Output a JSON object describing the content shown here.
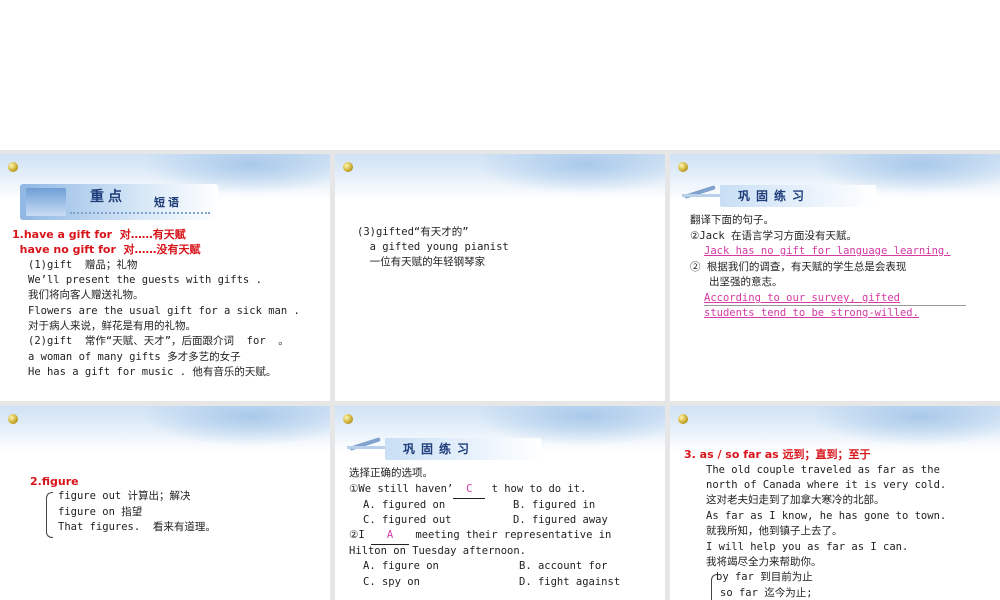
{
  "slide1": {
    "badge_main": "重点",
    "badge_sub": "短语",
    "lines": [
      "1.have a gift for  对……有天赋",
      "  have no gift for  对……没有天赋"
    ],
    "body": [
      "(1)gift  赠品；礼物",
      "We’ll present the guests with gifts .",
      "我们将向客人赠送礼物。",
      "Flowers are the usual gift for a sick man .",
      "对于病人来说，鲜花是有用的礼物。",
      "(2)gift  常作“天赋、天才”，后面跟介词  for  。",
      "a woman of many gifts 多才多艺的女子",
      "He has a gift for music . 他有音乐的天赋。"
    ]
  },
  "slide2": {
    "body": [
      "(3)gifted“有天才的”",
      "  a gifted young pianist",
      "  一位有天赋的年轻钢琴家"
    ]
  },
  "slide3": {
    "banner": "巩固练习",
    "intro": "翻译下面的句子。",
    "q1": "②Jack 在语言学习方面没有天赋。",
    "a1": "Jack has no gift for language learning.",
    "q2a": "② 根据我们的调查，有天赋的学生总是会表现",
    "q2b": "   出坚强的意志。",
    "a2a": "According to our survey, gifted",
    "a2b": "students tend to be strong-willed."
  },
  "slide4": {
    "heading": "2.figure",
    "items": [
      "figure out 计算出；解决",
      "figure on 指望",
      "That figures.  看来有道理。"
    ]
  },
  "slide5": {
    "banner": "巩固练习",
    "intro": "选择正确的选项。",
    "q1_pre": "①We still haven’",
    "q1_ans": "C",
    "q1_post": " t how to do it.",
    "q1_opts": [
      "A. figured on",
      "B. figured in",
      "C. figured out",
      "D. figured away"
    ],
    "q2_pre": "②I ",
    "q2_ans": "A",
    "q2_post": " meeting their representative in",
    "q2_line2": "Hilton on Tuesday afternoon.",
    "q2_opts": [
      "A. figure on",
      "B. account for",
      "C. spy on",
      "D. fight against"
    ]
  },
  "slide6": {
    "heading": "3. as / so far as 远到；直到；至于",
    "body": [
      "The old couple traveled as far as the",
      "north of Canada where it is very cold.",
      "这对老夫妇走到了加拿大寒冷的北部。",
      "As far as I know, he has gone to town.",
      "就我所知，他到镇子上去了。",
      "I will help you as far as I can.",
      "我将竭尽全力来帮助你。"
    ],
    "brace_items": [
      "by far 到目前为止",
      "so far 迄今为止;"
    ]
  }
}
